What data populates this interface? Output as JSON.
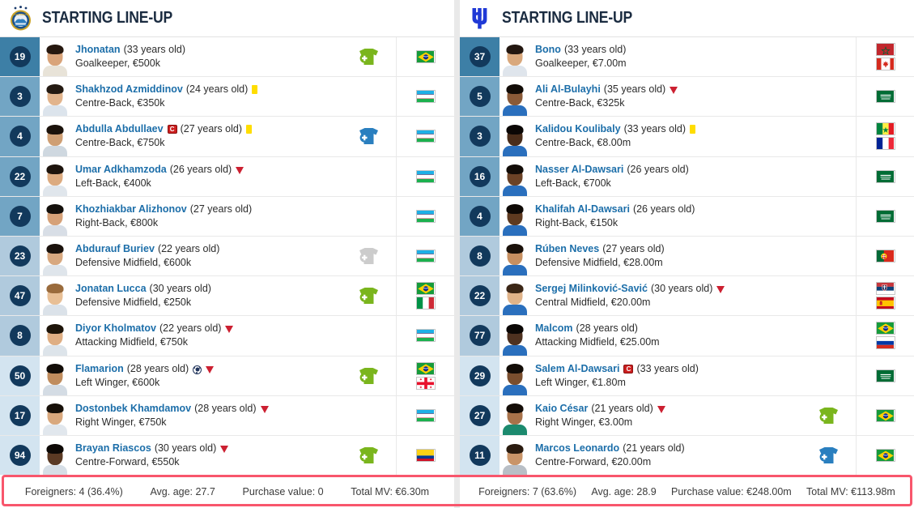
{
  "left": {
    "header": {
      "title": "STARTING LINE-UP",
      "logo_name": "pakhtakor-tashkent-logo"
    },
    "players": [
      {
        "number": "19",
        "name": "Jhonatan",
        "age": "(33 years old)",
        "position_value": "Goalkeeper, €500k",
        "group": "pos-gk",
        "card": "",
        "captain": false,
        "sub_off": false,
        "goal": false,
        "sub_icon": "green",
        "flags": [
          "brazil"
        ],
        "skin": "#d9a47a",
        "hair": "#26180f",
        "shirt": "#e8e3d8"
      },
      {
        "number": "3",
        "name": "Shakhzod Azmiddinov",
        "age": "(24 years old)",
        "position_value": "Centre-Back, €350k",
        "group": "pos-def",
        "card": "yellow",
        "captain": false,
        "sub_off": false,
        "goal": false,
        "sub_icon": "",
        "flags": [
          "uzbekistan"
        ],
        "skin": "#e2b48c",
        "hair": "#241a12",
        "shirt": "#dce4ec"
      },
      {
        "number": "4",
        "name": "Abdulla Abdullaev",
        "age": "(27 years old)",
        "position_value": "Centre-Back, €750k",
        "group": "pos-def",
        "card": "yellow",
        "captain": true,
        "sub_off": false,
        "goal": false,
        "sub_icon": "blue",
        "flags": [
          "uzbekistan"
        ],
        "skin": "#cf9f74",
        "hair": "#1b120b",
        "shirt": "#cfd8e0"
      },
      {
        "number": "22",
        "name": "Umar Adkhamzoda",
        "age": "(26 years old)",
        "position_value": "Left-Back, €400k",
        "group": "pos-def",
        "card": "",
        "captain": false,
        "sub_off": true,
        "goal": false,
        "sub_icon": "",
        "flags": [
          "uzbekistan"
        ],
        "skin": "#dcab80",
        "hair": "#1d140d",
        "shirt": "#e0e6ec"
      },
      {
        "number": "7",
        "name": "Khozhiakbar Alizhonov",
        "age": "(27 years old)",
        "position_value": "Right-Back, €800k",
        "group": "pos-def",
        "card": "",
        "captain": false,
        "sub_off": false,
        "goal": false,
        "sub_icon": "",
        "flags": [
          "uzbekistan"
        ],
        "skin": "#d6a178",
        "hair": "#14100c",
        "shirt": "#d8dee6"
      },
      {
        "number": "23",
        "name": "Abdurauf Buriev",
        "age": "(22 years old)",
        "position_value": "Defensive Midfield, €600k",
        "group": "pos-mid",
        "card": "",
        "captain": false,
        "sub_off": false,
        "goal": false,
        "sub_icon": "grey",
        "flags": [
          "uzbekistan"
        ],
        "skin": "#d8a87f",
        "hair": "#1a120c",
        "shirt": "#dfe5eb"
      },
      {
        "number": "47",
        "name": "Jonatan Lucca",
        "age": "(30 years old)",
        "position_value": "Defensive Midfield, €250k",
        "group": "pos-mid",
        "card": "",
        "captain": false,
        "sub_off": false,
        "goal": false,
        "sub_icon": "green",
        "flags": [
          "brazil",
          "italy"
        ],
        "skin": "#e8bf95",
        "hair": "#9a6b3c",
        "shirt": "#dbe2e9"
      },
      {
        "number": "8",
        "name": "Diyor Kholmatov",
        "age": "(22 years old)",
        "position_value": "Attacking Midfield, €750k",
        "group": "pos-mid",
        "card": "",
        "captain": false,
        "sub_off": true,
        "goal": false,
        "sub_icon": "",
        "flags": [
          "uzbekistan"
        ],
        "skin": "#dfae83",
        "hair": "#1d1409",
        "shirt": "#dde4ea"
      },
      {
        "number": "50",
        "name": "Flamarion",
        "age": "(28 years old)",
        "position_value": "Left Winger, €600k",
        "group": "pos-att",
        "card": "",
        "captain": false,
        "sub_off": true,
        "goal": true,
        "sub_icon": "green",
        "flags": [
          "brazil",
          "georgia"
        ],
        "skin": "#c08c5d",
        "hair": "#120d08",
        "shirt": "#d4dce4"
      },
      {
        "number": "17",
        "name": "Dostonbek Khamdamov",
        "age": "(28 years old)",
        "position_value": "Right Winger, €750k",
        "group": "pos-att",
        "card": "",
        "captain": false,
        "sub_off": true,
        "goal": false,
        "sub_icon": "",
        "flags": [
          "uzbekistan"
        ],
        "skin": "#d9a87d",
        "hair": "#171009",
        "shirt": "#e1e7ed"
      },
      {
        "number": "94",
        "name": "Brayan Riascos",
        "age": "(30 years old)",
        "position_value": "Centre-Forward, €550k",
        "group": "pos-att",
        "card": "",
        "captain": false,
        "sub_off": true,
        "goal": false,
        "sub_icon": "green",
        "flags": [
          "colombia"
        ],
        "skin": "#5b3a24",
        "hair": "#0d0906",
        "shirt": "#d6dee6"
      }
    ],
    "footer": {
      "foreigners": "Foreigners: 4 (36.4%)",
      "avg_age": "Avg. age: 27.7",
      "purchase_value": "Purchase value: 0",
      "total_mv": "Total MV: €6.30m"
    }
  },
  "right": {
    "header": {
      "title": "STARTING LINE-UP",
      "logo_name": "al-hilal-logo"
    },
    "players": [
      {
        "number": "37",
        "name": "Bono",
        "age": "(33 years old)",
        "position_value": "Goalkeeper, €7.00m",
        "group": "pos-gk",
        "card": "",
        "captain": false,
        "sub_off": false,
        "goal": false,
        "sub_icon": "",
        "flags": [
          "morocco",
          "canada"
        ],
        "skin": "#d9a87c",
        "hair": "#231710",
        "shirt": "#dfe5ec"
      },
      {
        "number": "5",
        "name": "Ali Al-Bulayhi",
        "age": "(35 years old)",
        "position_value": "Centre-Back, €325k",
        "group": "pos-def",
        "card": "",
        "captain": false,
        "sub_off": true,
        "goal": false,
        "sub_icon": "",
        "flags": [
          "saudi-arabia"
        ],
        "skin": "#8a5a38",
        "hair": "#120c07",
        "shirt": "#2a6fbd"
      },
      {
        "number": "3",
        "name": "Kalidou Koulibaly",
        "age": "(33 years old)",
        "position_value": "Centre-Back, €8.00m",
        "group": "pos-def",
        "card": "yellow",
        "captain": false,
        "sub_off": false,
        "goal": false,
        "sub_icon": "",
        "flags": [
          "senegal",
          "france"
        ],
        "skin": "#4a2d1a",
        "hair": "#0b0705",
        "shirt": "#2a6fbd"
      },
      {
        "number": "16",
        "name": "Nasser Al-Dawsari",
        "age": "(26 years old)",
        "position_value": "Left-Back, €700k",
        "group": "pos-def",
        "card": "",
        "captain": false,
        "sub_off": false,
        "goal": false,
        "sub_icon": "",
        "flags": [
          "saudi-arabia"
        ],
        "skin": "#6b4226",
        "hair": "#120c07",
        "shirt": "#2a6fbd"
      },
      {
        "number": "4",
        "name": "Khalifah Al-Dawsari",
        "age": "(26 years old)",
        "position_value": "Right-Back, €150k",
        "group": "pos-def",
        "card": "",
        "captain": false,
        "sub_off": false,
        "goal": false,
        "sub_icon": "",
        "flags": [
          "saudi-arabia"
        ],
        "skin": "#5e3a20",
        "hair": "#0e0905",
        "shirt": "#2a6fbd"
      },
      {
        "number": "8",
        "name": "Rúben Neves",
        "age": "(27 years old)",
        "position_value": "Defensive Midfield, €28.00m",
        "group": "pos-mid",
        "card": "",
        "captain": false,
        "sub_off": false,
        "goal": false,
        "sub_icon": "",
        "flags": [
          "portugal"
        ],
        "skin": "#c78f60",
        "hair": "#1a110a",
        "shirt": "#2a6fbd"
      },
      {
        "number": "22",
        "name": "Sergej Milinković-Savić",
        "age": "(30 years old)",
        "position_value": "Central Midfield, €20.00m",
        "group": "pos-mid",
        "card": "",
        "captain": false,
        "sub_off": true,
        "goal": false,
        "sub_icon": "",
        "flags": [
          "serbia",
          "spain"
        ],
        "skin": "#e0b389",
        "hair": "#3b2616",
        "shirt": "#2a6fbd"
      },
      {
        "number": "77",
        "name": "Malcom",
        "age": "(28 years old)",
        "position_value": "Attacking Midfield, €25.00m",
        "group": "pos-mid",
        "card": "",
        "captain": false,
        "sub_off": false,
        "goal": false,
        "sub_icon": "",
        "flags": [
          "brazil",
          "russia"
        ],
        "skin": "#4e3120",
        "hair": "#0b0705",
        "shirt": "#2a6fbd"
      },
      {
        "number": "29",
        "name": "Salem Al-Dawsari",
        "age": "(33 years old)",
        "position_value": "Left Winger, €1.80m",
        "group": "pos-att",
        "card": "",
        "captain": true,
        "sub_off": false,
        "goal": false,
        "sub_icon": "",
        "flags": [
          "saudi-arabia"
        ],
        "skin": "#7a4e2e",
        "hair": "#120c07",
        "shirt": "#2a6fbd"
      },
      {
        "number": "27",
        "name": "Kaio César",
        "age": "(21 years old)",
        "position_value": "Right Winger, €3.00m",
        "group": "pos-att",
        "card": "",
        "captain": false,
        "sub_off": true,
        "goal": false,
        "sub_icon": "green",
        "flags": [
          "brazil"
        ],
        "skin": "#a8724a",
        "hair": "#140d08",
        "shirt": "#1c8a6e"
      },
      {
        "number": "11",
        "name": "Marcos Leonardo",
        "age": "(21 years old)",
        "position_value": "Centre-Forward, €20.00m",
        "group": "pos-att",
        "card": "",
        "captain": false,
        "sub_off": false,
        "goal": false,
        "sub_icon": "blue",
        "flags": [
          "brazil"
        ],
        "skin": "#c99468",
        "hair": "#2a1b0f",
        "shirt": "#b9bfc6"
      }
    ],
    "footer": {
      "foreigners": "Foreigners: 7 (63.6%)",
      "avg_age": "Avg. age: 28.9",
      "purchase_value": "Purchase value: €248.00m",
      "total_mv": "Total MV: €113.98m"
    }
  },
  "colors": {
    "name_link": "#1c6ea9",
    "number_badge": "#12395c",
    "highlight_border": "#f8566c",
    "sub_in_green": "#7ab51d",
    "sub_in_blue": "#2a7fbf",
    "sub_in_grey": "#cccccc",
    "yellow_card": "#ffdd00",
    "red_arrow": "#cc2031"
  }
}
